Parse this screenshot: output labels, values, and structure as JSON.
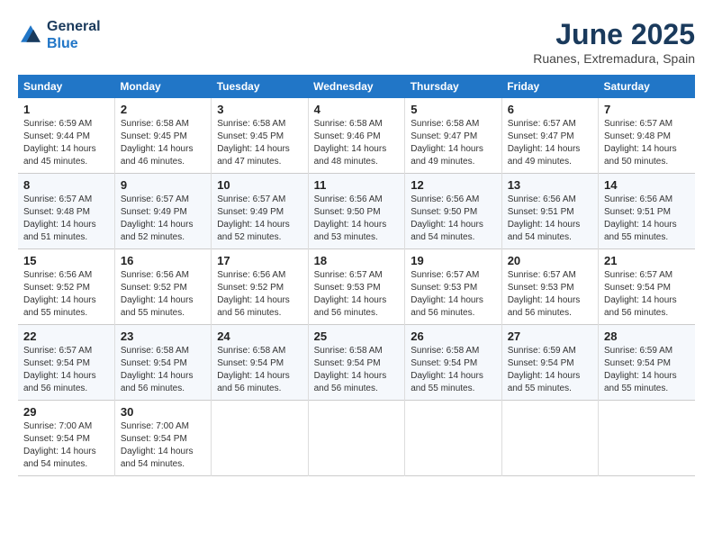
{
  "header": {
    "logo_line1": "General",
    "logo_line2": "Blue",
    "month": "June 2025",
    "location": "Ruanes, Extremadura, Spain"
  },
  "weekdays": [
    "Sunday",
    "Monday",
    "Tuesday",
    "Wednesday",
    "Thursday",
    "Friday",
    "Saturday"
  ],
  "weeks": [
    [
      {
        "day": "1",
        "sunrise": "6:59 AM",
        "sunset": "9:44 PM",
        "daylight": "14 hours and 45 minutes."
      },
      {
        "day": "2",
        "sunrise": "6:58 AM",
        "sunset": "9:45 PM",
        "daylight": "14 hours and 46 minutes."
      },
      {
        "day": "3",
        "sunrise": "6:58 AM",
        "sunset": "9:45 PM",
        "daylight": "14 hours and 47 minutes."
      },
      {
        "day": "4",
        "sunrise": "6:58 AM",
        "sunset": "9:46 PM",
        "daylight": "14 hours and 48 minutes."
      },
      {
        "day": "5",
        "sunrise": "6:58 AM",
        "sunset": "9:47 PM",
        "daylight": "14 hours and 49 minutes."
      },
      {
        "day": "6",
        "sunrise": "6:57 AM",
        "sunset": "9:47 PM",
        "daylight": "14 hours and 49 minutes."
      },
      {
        "day": "7",
        "sunrise": "6:57 AM",
        "sunset": "9:48 PM",
        "daylight": "14 hours and 50 minutes."
      }
    ],
    [
      {
        "day": "8",
        "sunrise": "6:57 AM",
        "sunset": "9:48 PM",
        "daylight": "14 hours and 51 minutes."
      },
      {
        "day": "9",
        "sunrise": "6:57 AM",
        "sunset": "9:49 PM",
        "daylight": "14 hours and 52 minutes."
      },
      {
        "day": "10",
        "sunrise": "6:57 AM",
        "sunset": "9:49 PM",
        "daylight": "14 hours and 52 minutes."
      },
      {
        "day": "11",
        "sunrise": "6:56 AM",
        "sunset": "9:50 PM",
        "daylight": "14 hours and 53 minutes."
      },
      {
        "day": "12",
        "sunrise": "6:56 AM",
        "sunset": "9:50 PM",
        "daylight": "14 hours and 54 minutes."
      },
      {
        "day": "13",
        "sunrise": "6:56 AM",
        "sunset": "9:51 PM",
        "daylight": "14 hours and 54 minutes."
      },
      {
        "day": "14",
        "sunrise": "6:56 AM",
        "sunset": "9:51 PM",
        "daylight": "14 hours and 55 minutes."
      }
    ],
    [
      {
        "day": "15",
        "sunrise": "6:56 AM",
        "sunset": "9:52 PM",
        "daylight": "14 hours and 55 minutes."
      },
      {
        "day": "16",
        "sunrise": "6:56 AM",
        "sunset": "9:52 PM",
        "daylight": "14 hours and 55 minutes."
      },
      {
        "day": "17",
        "sunrise": "6:56 AM",
        "sunset": "9:52 PM",
        "daylight": "14 hours and 56 minutes."
      },
      {
        "day": "18",
        "sunrise": "6:57 AM",
        "sunset": "9:53 PM",
        "daylight": "14 hours and 56 minutes."
      },
      {
        "day": "19",
        "sunrise": "6:57 AM",
        "sunset": "9:53 PM",
        "daylight": "14 hours and 56 minutes."
      },
      {
        "day": "20",
        "sunrise": "6:57 AM",
        "sunset": "9:53 PM",
        "daylight": "14 hours and 56 minutes."
      },
      {
        "day": "21",
        "sunrise": "6:57 AM",
        "sunset": "9:54 PM",
        "daylight": "14 hours and 56 minutes."
      }
    ],
    [
      {
        "day": "22",
        "sunrise": "6:57 AM",
        "sunset": "9:54 PM",
        "daylight": "14 hours and 56 minutes."
      },
      {
        "day": "23",
        "sunrise": "6:58 AM",
        "sunset": "9:54 PM",
        "daylight": "14 hours and 56 minutes."
      },
      {
        "day": "24",
        "sunrise": "6:58 AM",
        "sunset": "9:54 PM",
        "daylight": "14 hours and 56 minutes."
      },
      {
        "day": "25",
        "sunrise": "6:58 AM",
        "sunset": "9:54 PM",
        "daylight": "14 hours and 56 minutes."
      },
      {
        "day": "26",
        "sunrise": "6:58 AM",
        "sunset": "9:54 PM",
        "daylight": "14 hours and 55 minutes."
      },
      {
        "day": "27",
        "sunrise": "6:59 AM",
        "sunset": "9:54 PM",
        "daylight": "14 hours and 55 minutes."
      },
      {
        "day": "28",
        "sunrise": "6:59 AM",
        "sunset": "9:54 PM",
        "daylight": "14 hours and 55 minutes."
      }
    ],
    [
      {
        "day": "29",
        "sunrise": "7:00 AM",
        "sunset": "9:54 PM",
        "daylight": "14 hours and 54 minutes."
      },
      {
        "day": "30",
        "sunrise": "7:00 AM",
        "sunset": "9:54 PM",
        "daylight": "14 hours and 54 minutes."
      },
      null,
      null,
      null,
      null,
      null
    ]
  ]
}
